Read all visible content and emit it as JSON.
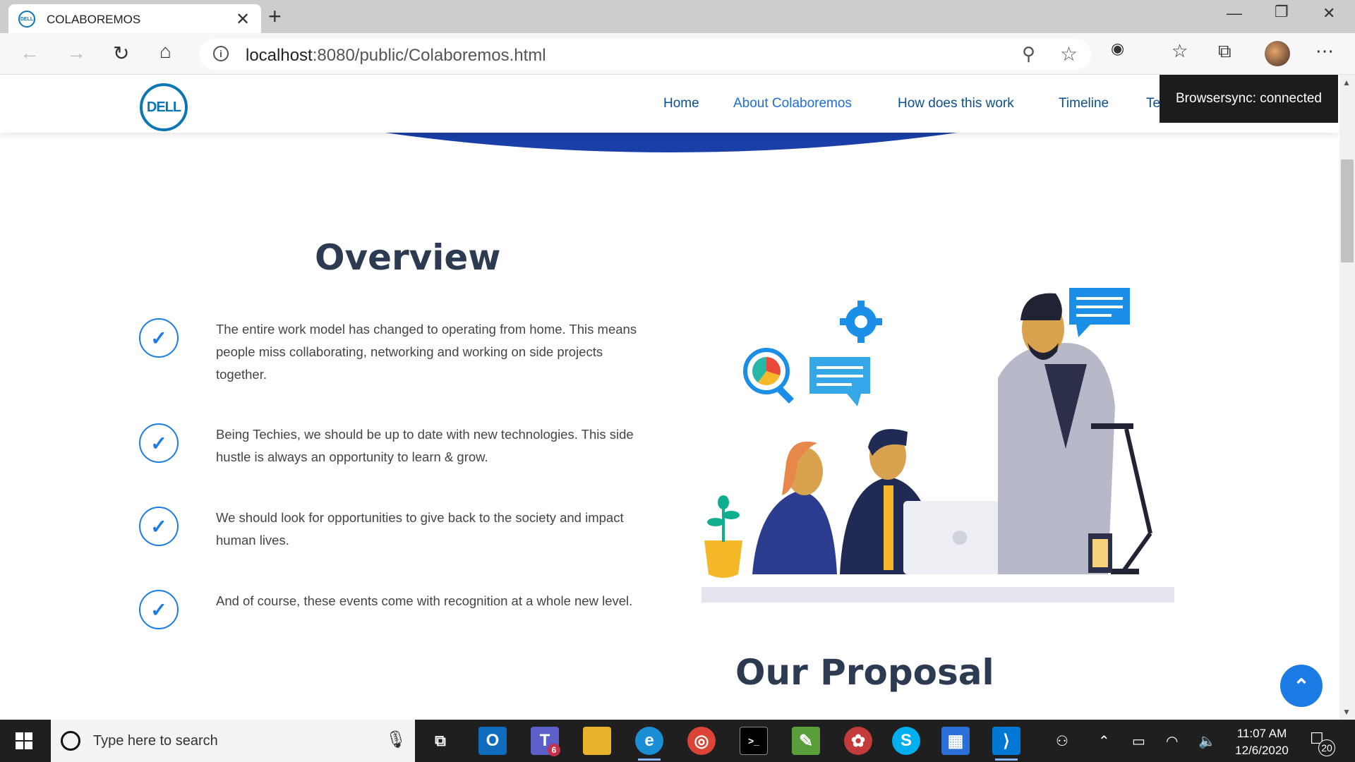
{
  "browser": {
    "tab_title": "COLABOREMOS",
    "favicon_text": "DELL",
    "url_host": "localhost",
    "url_path": ":8080/public/Colaboremos.html",
    "icons": [
      "back-icon",
      "forward-icon",
      "refresh-icon",
      "home-icon",
      "info-icon",
      "zoom-icon",
      "favorite-star-icon",
      "extension-icon",
      "favorites-icon",
      "collections-icon",
      "profile-avatar",
      "more-icon"
    ]
  },
  "site": {
    "logo_text": "DELL",
    "nav": [
      {
        "label": "Home"
      },
      {
        "label": "About Colaboremos"
      },
      {
        "label": "How does this work"
      },
      {
        "label": "Timeline"
      },
      {
        "label": "Te"
      }
    ],
    "browsersync_toast": "Browsersync: connected",
    "accent_color": "#1b7ce6",
    "hero_color": "#1a3fa8"
  },
  "overview": {
    "title": "Overview",
    "items": [
      {
        "text": "The entire work model has changed to operating from home. This means people miss collaborating, networking and working on side projects together."
      },
      {
        "text": "Being Techies, we should be up to date with new technologies. This side hustle is always an opportunity to learn & grow."
      },
      {
        "text": "We should look for opportunities to give back to the society and impact human lives."
      },
      {
        "text": "And of course, these events come with recognition at a whole new level."
      }
    ]
  },
  "proposal": {
    "title": "Our Proposal"
  },
  "taskbar": {
    "search_placeholder": "Type here to search",
    "teams_badge": "6",
    "time": "11:07 AM",
    "date": "12/6/2020",
    "notification_count": "20"
  }
}
